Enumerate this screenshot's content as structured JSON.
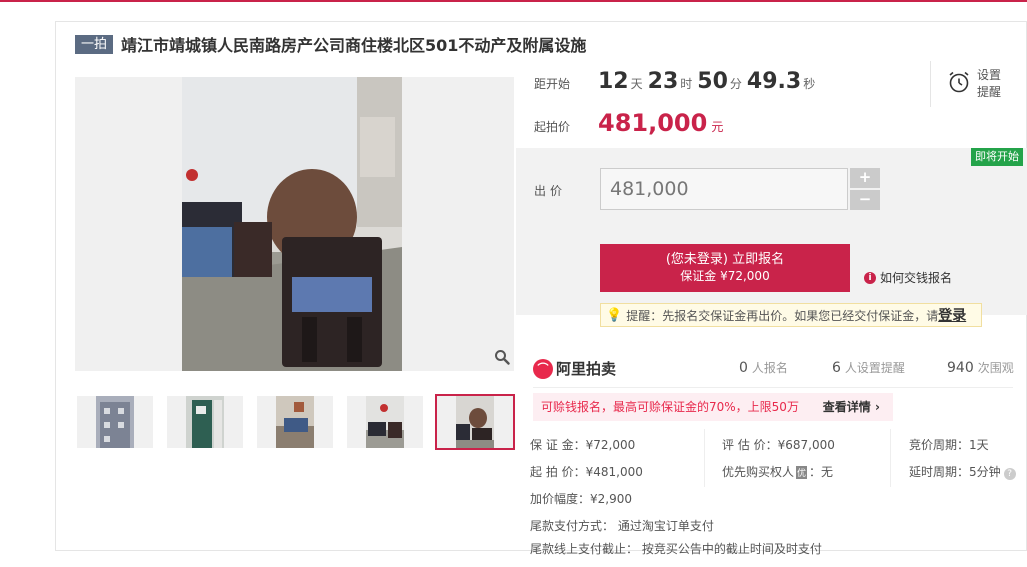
{
  "title": {
    "badge": "一拍",
    "text": "靖江市靖城镇人民南路房产公司商住楼北区501不动产及附属设施"
  },
  "countdown": {
    "label": "距开始",
    "days": "12",
    "days_unit": "天",
    "hours": "23",
    "hours_unit": "时",
    "minutes": "50",
    "minutes_unit": "分",
    "seconds": "49.3",
    "seconds_unit": "秒"
  },
  "start_price": {
    "label": "起拍价",
    "value": "481,000",
    "unit": "元"
  },
  "reminder": {
    "label": "设置提醒",
    "icon": "alarm-clock-icon"
  },
  "status_tag": "即将开始",
  "bid": {
    "label": "出价",
    "value": "481,000",
    "plus": "+",
    "minus": "−",
    "signup_line1": "(您未登录) 立即报名",
    "signup_line2": "保证金 ¥72,000",
    "how_to_pay": "如何交钱报名",
    "tip_text": "提醒：先报名交保证金再出价。如果您已经交付保证金，请",
    "tip_login": "登录"
  },
  "platform": {
    "logo_text": "阿里拍卖"
  },
  "stats": {
    "signups": "0",
    "signups_label": "人报名",
    "reminders": "6",
    "reminders_label": "人设置提醒",
    "views": "940",
    "views_label": "次围观"
  },
  "deposit_banner": {
    "text": "可赊钱报名，最高可赊保证金的70%，上限50万",
    "details": "查看详情 ›"
  },
  "details": {
    "deposit": "保 证 金：¥72,000",
    "appraisal": "评 估 价：¥687,000",
    "cycle": "竞价周期：1天",
    "start": "起 拍 价：¥481,000",
    "priority_prefix": "优先购买权人",
    "priority_tag": "优",
    "priority_value": "：无",
    "delay": "延时周期：5分钟",
    "increment": "加价幅度：¥2,900",
    "payment_method": "尾款支付方式：  通过淘宝订单支付",
    "payment_deadline": "尾款线上支付截止：  按竞买公告中的截止时间及时支付"
  },
  "colors": {
    "accent": "#c9234a",
    "green_tag": "#24a34a"
  }
}
